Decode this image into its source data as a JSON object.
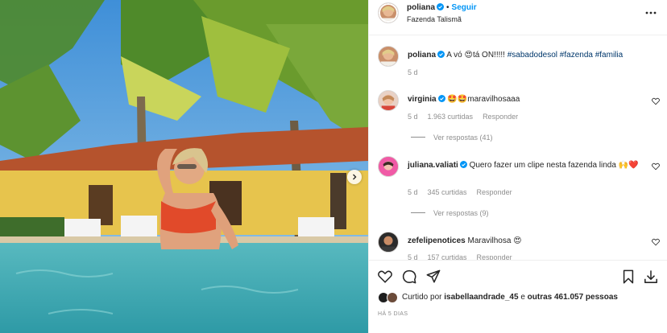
{
  "post": {
    "author": {
      "username": "poliana",
      "follow_label": "Seguir",
      "separator": "•",
      "location": "Fazenda Talismã"
    },
    "caption": {
      "username": "poliana",
      "text_a": "A vó",
      "emoji": "😍",
      "text_b": "tá ON!!!!!",
      "hashtags": "#sabadodesol #fazenda #familia",
      "time": "5 d"
    },
    "comments": [
      {
        "username": "virginia",
        "text": "🤩🤩maravilhosaaa",
        "time": "5 d",
        "likes": "1.963 curtidas",
        "reply_label": "Responder",
        "view_replies": "Ver respostas (41)"
      },
      {
        "username": "juliana.valiati",
        "text": "Quero fazer um clipe nesta fazenda linda 🙌❤️",
        "time": "5 d",
        "likes": "345 curtidas",
        "reply_label": "Responder",
        "view_replies": "Ver respostas (9)"
      },
      {
        "username": "zefelipenotices",
        "text": "Maravilhosa 😍",
        "time": "5 d",
        "likes": "157 curtidas",
        "reply_label": "Responder"
      }
    ],
    "liked_by": {
      "prefix": "Curtido por",
      "user": "isabellaandrade_45",
      "middle": "e",
      "others": "outras 461.057 pessoas"
    },
    "time_ago": "HÁ 5 DIAS"
  },
  "icons": {
    "more": "more-dots-icon",
    "verified": "verified-badge-icon",
    "like": "heart-icon",
    "comment": "comment-bubble-icon",
    "share": "paper-plane-icon",
    "save": "bookmark-icon",
    "download": "download-icon",
    "next": "chevron-right-icon"
  },
  "colors": {
    "link": "#0095f6",
    "hashtag": "#00376b",
    "muted": "#8e8e8e",
    "verified": "#0095f6"
  }
}
